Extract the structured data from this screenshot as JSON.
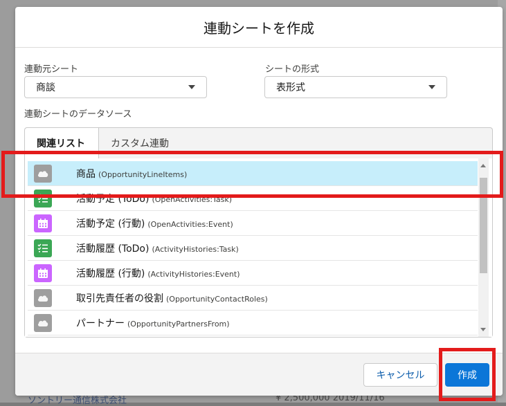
{
  "modal": {
    "title": "連動シートを作成",
    "source_sheet_label": "連動元シート",
    "source_sheet_value": "商談",
    "sheet_format_label": "シートの形式",
    "sheet_format_value": "表形式",
    "datasource_label": "連動シートのデータソース",
    "tabs": [
      {
        "label": "関連リスト",
        "active": true
      },
      {
        "label": "カスタム連動",
        "active": false
      }
    ],
    "items": [
      {
        "label": "商品",
        "sub": "(OpportunityLineItems)",
        "icon": "cloud-icon",
        "selected": true
      },
      {
        "label": "活動予定 (ToDo)",
        "sub": "(OpenActivities:Task)",
        "icon": "task-list-icon",
        "selected": false
      },
      {
        "label": "活動予定 (行動)",
        "sub": "(OpenActivities:Event)",
        "icon": "calendar-icon",
        "selected": false
      },
      {
        "label": "活動履歴 (ToDo)",
        "sub": "(ActivityHistories:Task)",
        "icon": "task-list-icon",
        "selected": false
      },
      {
        "label": "活動履歴 (行動)",
        "sub": "(ActivityHistories:Event)",
        "icon": "calendar-icon",
        "selected": false
      },
      {
        "label": "取引先責任者の役割",
        "sub": "(OpportunityContactRoles)",
        "icon": "cloud-icon",
        "selected": false
      },
      {
        "label": "パートナー",
        "sub": "(OpportunityPartnersFrom)",
        "icon": "cloud-icon",
        "selected": false
      }
    ],
    "cancel_label": "キャンセル",
    "create_label": "作成"
  },
  "background": {
    "bottom_left_text": "ソントリー通信株式会社",
    "bottom_right_text": "¥ 2,500,000  2019/11/16"
  },
  "colors": {
    "selected_row": "#c7eefb",
    "primary_button": "#0b76d8",
    "highlight_box": "#e31b1b",
    "task_icon": "#3ba755",
    "event_icon": "#cb65ff",
    "cloud_icon": "#9e9e9e"
  }
}
